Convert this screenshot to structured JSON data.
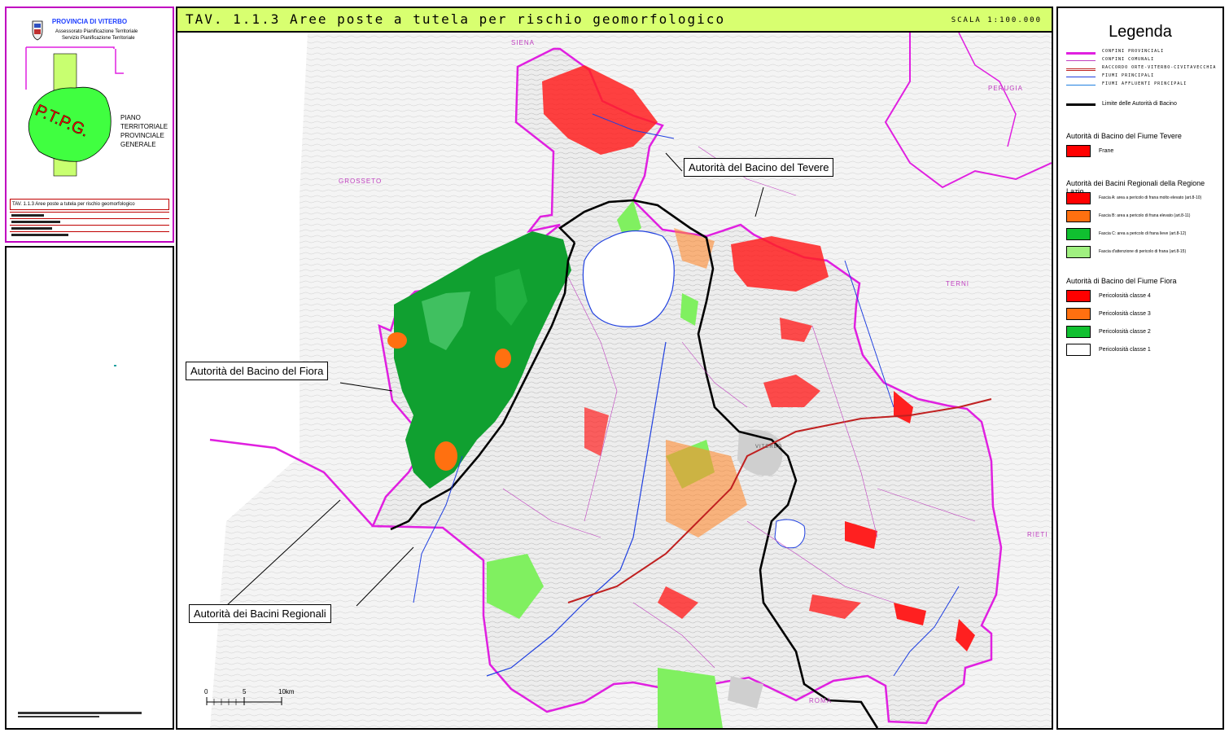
{
  "title": "TAV. 1.1.3 Aree poste a tutela per rischio geomorfologico",
  "scale": "SCALA 1:100.000",
  "header_panel": {
    "province": "PROVINCIA DI VITERBO",
    "dept_line1": "Assessorato Pianificazione Territoriale",
    "dept_line2": "Servizio Pianificazione Territoriale",
    "piano": [
      "PIANO",
      "TERRITORIALE",
      "PROVINCIALE",
      "GENERALE"
    ],
    "logo_letters": "P.T.P.G.",
    "table_title": "TAV. 1.1.3 Aree poste a tutela per rischio geomorfologico"
  },
  "map": {
    "places": [
      {
        "id": "siena",
        "label": "SIENA"
      },
      {
        "id": "perugia",
        "label": "PERUGIA"
      },
      {
        "id": "grosseto",
        "label": "GROSSETO"
      },
      {
        "id": "terni",
        "label": "TERNI"
      },
      {
        "id": "rieti",
        "label": "RIETI"
      },
      {
        "id": "roma",
        "label": "ROMA"
      },
      {
        "id": "viterbo",
        "label": "VITERBO"
      }
    ],
    "callouts": {
      "tevere": "Autorità del Bacino del Tevere",
      "fiora": "Autorità del Bacino del Fiora",
      "regionali": "Autorità dei Bacini Regionali"
    },
    "scalebar": {
      "ticks": [
        "0",
        "5",
        "10km"
      ]
    }
  },
  "legend": {
    "title": "Legenda",
    "lines": [
      {
        "label": "CONFINI PROVINCIALI",
        "color": "#e020e0",
        "style": "solid",
        "width": 3
      },
      {
        "label": "CONFINI COMUNALI",
        "color": "#c040c0",
        "style": "solid",
        "width": 1
      },
      {
        "label": "RACCORDO ORTE-VITERBO-CIVITAVECCHIA",
        "color": "#c02020",
        "style": "double",
        "width": 2
      },
      {
        "label": "FIUMI PRINCIPALI",
        "color": "#2040e0",
        "style": "solid",
        "width": 1
      },
      {
        "label": "FIUMI AFFLUENTI PRINCIPALI",
        "color": "#2080e0",
        "style": "solid",
        "width": 1
      }
    ],
    "boundary_label": "Limite delle Autorità di Bacino",
    "groups": [
      {
        "heading": "Autorità di Bacino del Fiume Tevere",
        "items": [
          {
            "label": "Frane",
            "color": "#ff0000"
          }
        ]
      },
      {
        "heading": "Autorità dei Bacini Regionali della Regione Lazio",
        "items": [
          {
            "label": "Fascia A: area a pericolo di frana molto elevato (art.8-10)",
            "color": "#ff0000"
          },
          {
            "label": "Fascia B: area a pericolo di frana elevato (art.8-11)",
            "color": "#ff7010"
          },
          {
            "label": "Fascia C: area a pericolo di frana lieve (art.8-12)",
            "color": "#10c030"
          },
          {
            "label": "Fascia d'attenzione di pericolo di frana (art.8-15)",
            "color": "#a0f080"
          }
        ]
      },
      {
        "heading": "Autorità di Bacino del Fiume Fiora",
        "items": [
          {
            "label": "Pericolosità classe 4",
            "color": "#ff0000"
          },
          {
            "label": "Pericolosità classe 3",
            "color": "#ff7010"
          },
          {
            "label": "Pericolosità classe 2",
            "color": "#10c030"
          },
          {
            "label": "Pericolosità classe 1",
            "color": "#ffffff"
          }
        ]
      }
    ]
  }
}
